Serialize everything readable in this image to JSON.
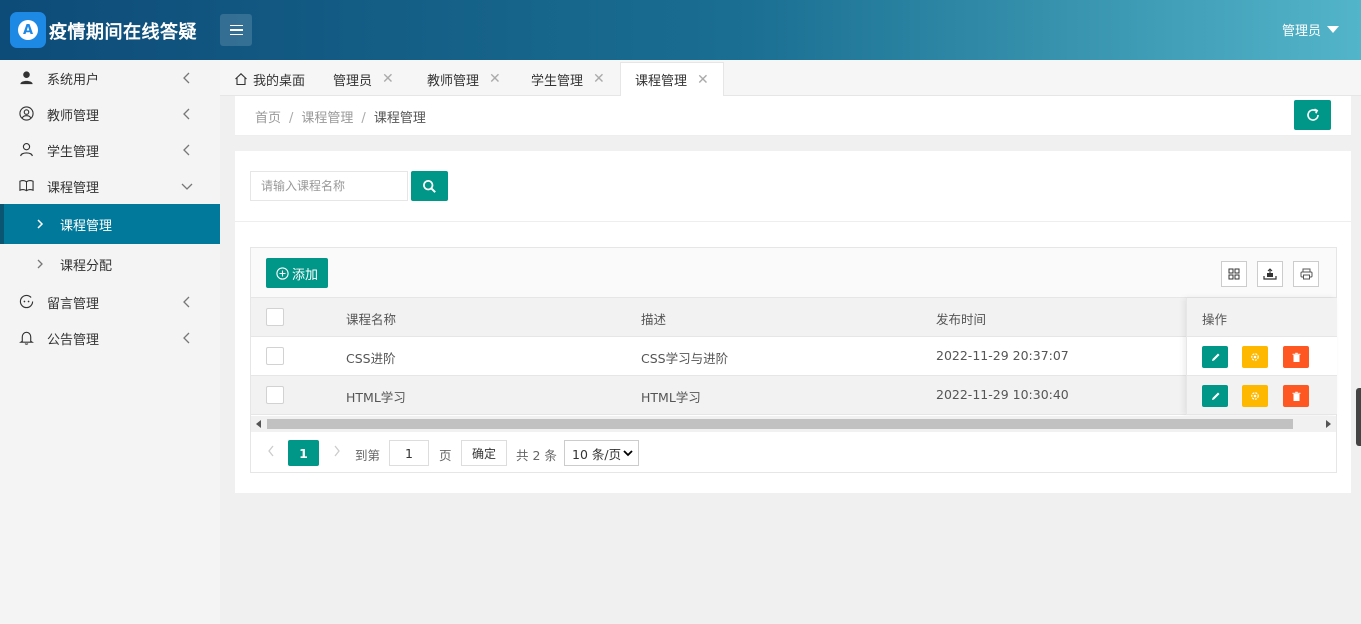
{
  "header": {
    "app_title": "疫情期间在线答疑",
    "logo_letter": "A",
    "user_label": "管理员"
  },
  "sidebar": {
    "items": [
      {
        "label": "系统用户",
        "icon": "user-solid-icon"
      },
      {
        "label": "教师管理",
        "icon": "user-circle-icon"
      },
      {
        "label": "学生管理",
        "icon": "user-outline-icon"
      },
      {
        "label": "课程管理",
        "icon": "book-icon",
        "expanded": true,
        "children": [
          {
            "label": "课程管理",
            "active": true
          },
          {
            "label": "课程分配",
            "active": false
          }
        ]
      },
      {
        "label": "留言管理",
        "icon": "comment-face-icon"
      },
      {
        "label": "公告管理",
        "icon": "bell-icon"
      }
    ]
  },
  "tabs": [
    {
      "label": "我的桌面",
      "closable": false
    },
    {
      "label": "管理员",
      "closable": true
    },
    {
      "label": "教师管理",
      "closable": true
    },
    {
      "label": "学生管理",
      "closable": true
    },
    {
      "label": "课程管理",
      "closable": true,
      "active": true
    }
  ],
  "breadcrumb": [
    "首页",
    "课程管理",
    "课程管理"
  ],
  "breadcrumb_sep": "/",
  "search": {
    "placeholder": "请输入课程名称"
  },
  "toolbar": {
    "add_label": "添加"
  },
  "table": {
    "columns": [
      "课程名称",
      "描述",
      "发布时间",
      "操作"
    ],
    "rows": [
      {
        "name": "CSS进阶",
        "desc": "CSS学习与进阶",
        "time": "2022-11-29 20:37:07"
      },
      {
        "name": "HTML学习",
        "desc": "HTML学习",
        "time": "2022-11-29 10:30:40"
      }
    ]
  },
  "pagination": {
    "current_page": "1",
    "goto_label": "到第",
    "goto_value": "1",
    "page_unit": "页",
    "confirm_label": "确定",
    "total_label": "共 2 条",
    "page_size_label": "10 条/页"
  },
  "colors": {
    "primary": "#009688",
    "sidebar_active": "#00799b",
    "warn": "#ffb800",
    "danger": "#ff5722"
  }
}
